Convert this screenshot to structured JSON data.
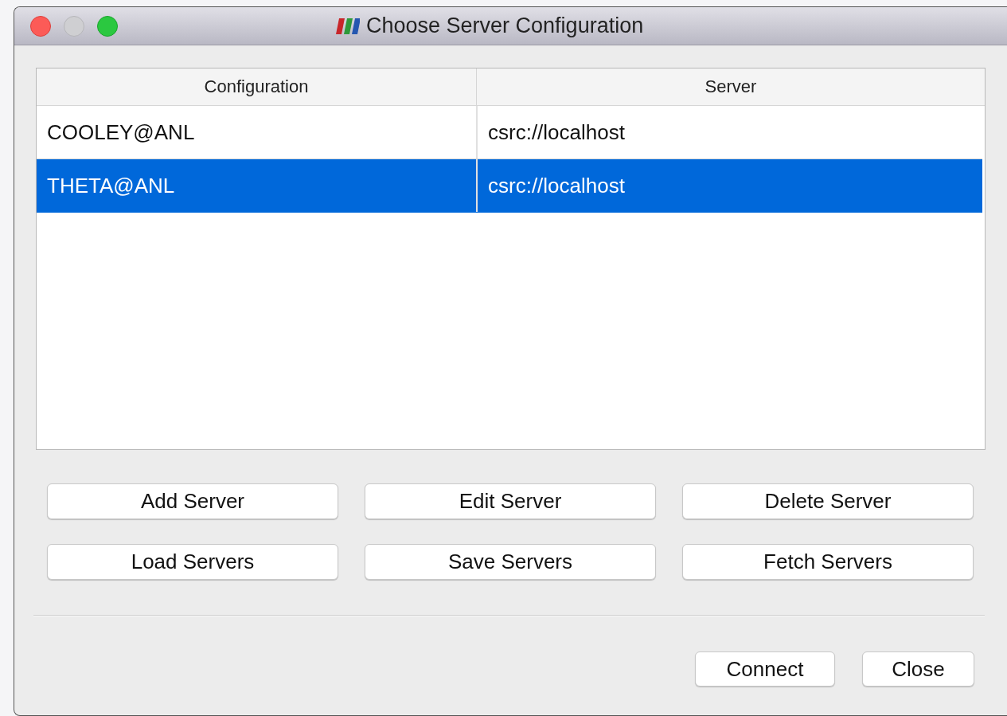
{
  "window": {
    "title": "Choose Server Configuration"
  },
  "table": {
    "columns": [
      "Configuration",
      "Server"
    ],
    "rows": [
      {
        "configuration": "COOLEY@ANL",
        "server": "csrc://localhost",
        "selected": false
      },
      {
        "configuration": "THETA@ANL",
        "server": "csrc://localhost",
        "selected": true
      }
    ]
  },
  "buttons": [
    "Add Server",
    "Edit Server",
    "Delete Server",
    "Load Servers",
    "Save Servers",
    "Fetch Servers"
  ],
  "dialog_buttons": [
    "Connect",
    "Close"
  ]
}
